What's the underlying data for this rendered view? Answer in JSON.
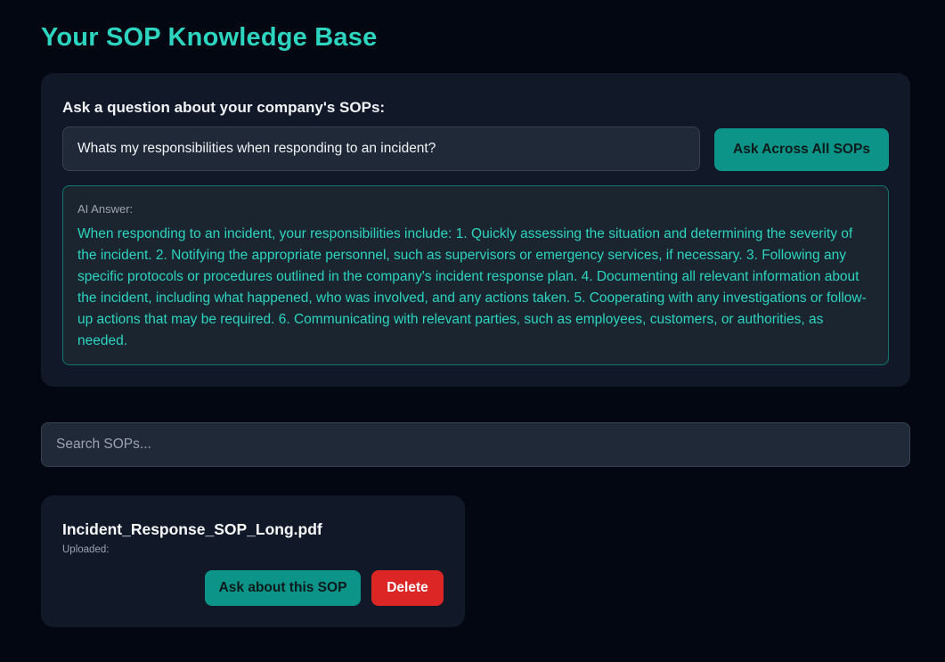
{
  "page": {
    "title": "Your SOP Knowledge Base"
  },
  "qa": {
    "label": "Ask a question about your company's SOPs:",
    "question_value": "Whats my responsibilities when responding to an incident?",
    "ask_all_label": "Ask Across All SOPs",
    "answer_label": "AI Answer:",
    "answer_text": "When responding to an incident, your responsibilities include: 1. Quickly assessing the situation and determining the severity of the incident. 2. Notifying the appropriate personnel, such as supervisors or emergency services, if necessary. 3. Following any specific protocols or procedures outlined in the company's incident response plan. 4. Documenting all relevant information about the incident, including what happened, who was involved, and any actions taken. 5. Cooperating with any investigations or follow-up actions that may be required. 6. Communicating with relevant parties, such as employees, customers, or authorities, as needed."
  },
  "search": {
    "placeholder": "Search SOPs..."
  },
  "sops": [
    {
      "filename": "Incident_Response_SOP_Long.pdf",
      "uploaded_label": "Uploaded:",
      "ask_label": "Ask about this SOP",
      "delete_label": "Delete"
    }
  ],
  "colors": {
    "background": "#030712",
    "card": "#111827",
    "accent": "#2dd4bf",
    "button_teal": "#0d9488",
    "danger": "#dc2626"
  }
}
